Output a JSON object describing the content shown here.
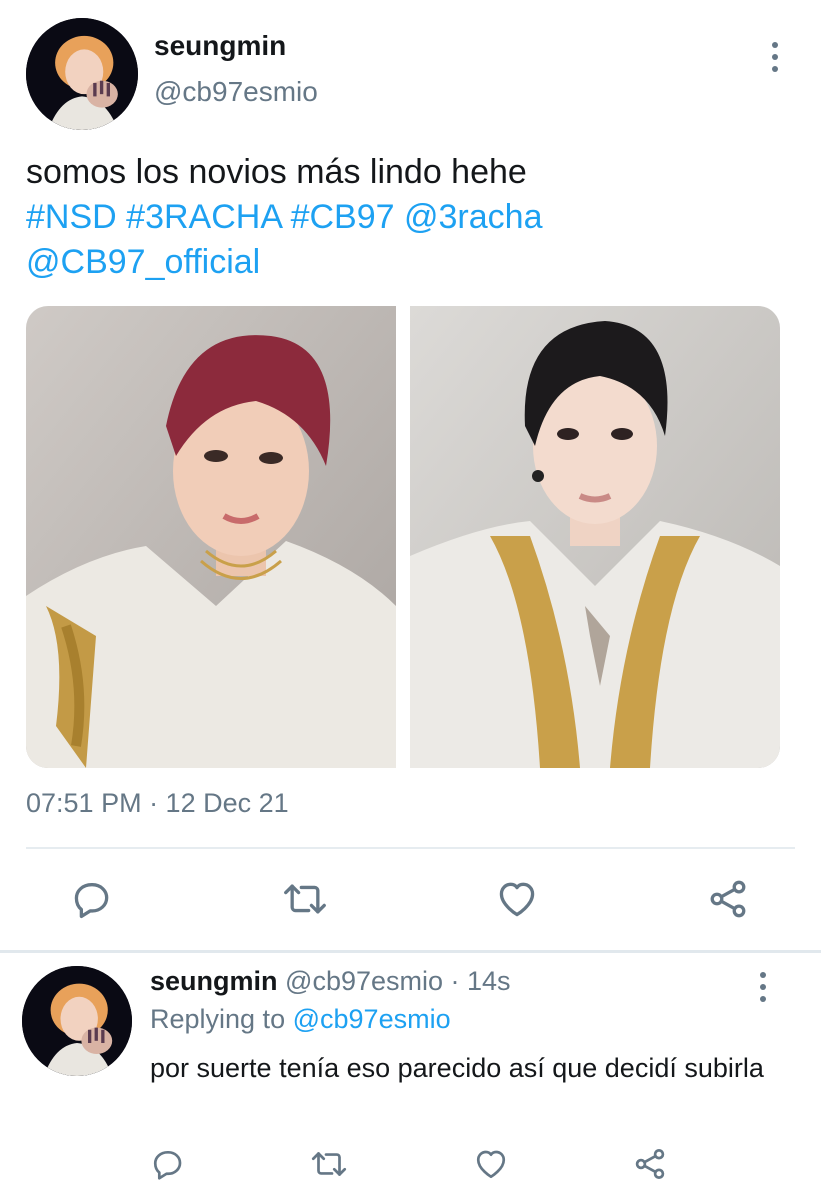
{
  "tweet": {
    "author": {
      "name": "seungmin",
      "handle": "@cb97esmio",
      "avatar_icon": "profile-avatar"
    },
    "text_line1": "somos los novios más lindo hehe",
    "tags": [
      "#NSD",
      "#3RACHA",
      "#CB97",
      "@3racha",
      "@CB97_official"
    ],
    "media": [
      {
        "icon": "photo-red-haired-person-white-jacket"
      },
      {
        "icon": "photo-dark-haired-person-white-jacket"
      }
    ],
    "timestamp": "07:51 PM · 12 Dec 21",
    "actions": [
      "reply-icon",
      "retweet-icon",
      "like-icon",
      "share-icon"
    ]
  },
  "reply": {
    "author": {
      "name": "seungmin",
      "handle": "@cb97esmio",
      "time": "· 14s",
      "avatar_icon": "profile-avatar"
    },
    "replying_prefix": "Replying to",
    "replying_to": "@cb97esmio",
    "text": "por suerte tenía eso parecido así que decidí subirla",
    "actions": [
      "reply-icon",
      "retweet-icon",
      "like-icon",
      "share-icon"
    ]
  },
  "colors": {
    "link": "#1da1f2",
    "secondary_text": "#657786",
    "divider": "#e6ecf0"
  }
}
